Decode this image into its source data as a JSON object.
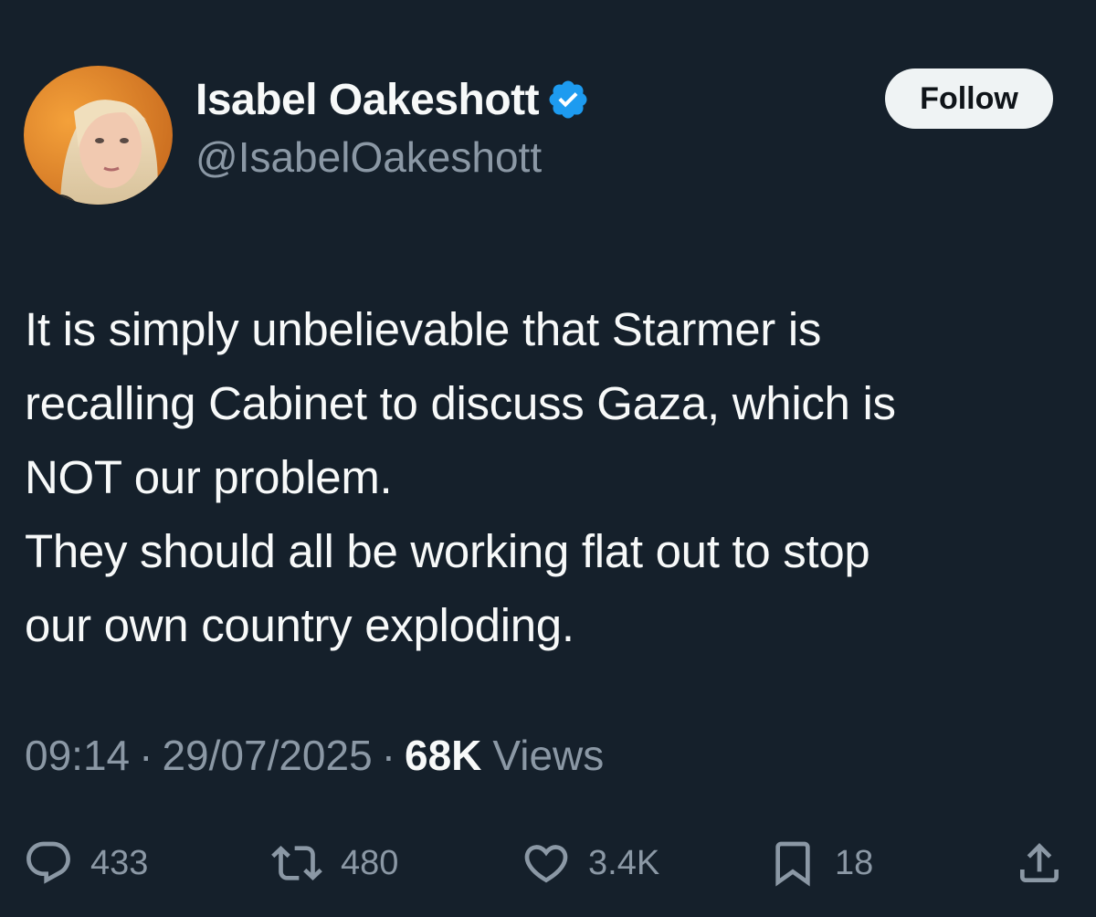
{
  "author": {
    "display_name": "Isabel Oakeshott",
    "handle": "@IsabelOakeshott",
    "verified": true
  },
  "follow_label": "Follow",
  "tweet": {
    "lines": [
      "It is simply unbelievable that Starmer is",
      "recalling Cabinet to discuss Gaza, which is",
      "NOT our problem.",
      "They should all be working flat out to stop",
      "our own country exploding."
    ]
  },
  "meta": {
    "time": "09:14",
    "separator": "·",
    "date": "29/07/2025",
    "views_count": "68K",
    "views_label": "Views"
  },
  "actions": {
    "replies": "433",
    "reposts": "480",
    "likes": "3.4K",
    "bookmarks": "18"
  },
  "colors": {
    "background": "#15202b",
    "text": "#f7f9f9",
    "secondary": "#8b98a5",
    "verified_blue": "#1d9bf0",
    "follow_bg": "#eff3f4"
  },
  "icons": {
    "verified": "verified-badge-icon",
    "reply": "reply-icon",
    "repost": "repost-icon",
    "like": "heart-icon",
    "bookmark": "bookmark-icon",
    "share": "share-icon"
  }
}
